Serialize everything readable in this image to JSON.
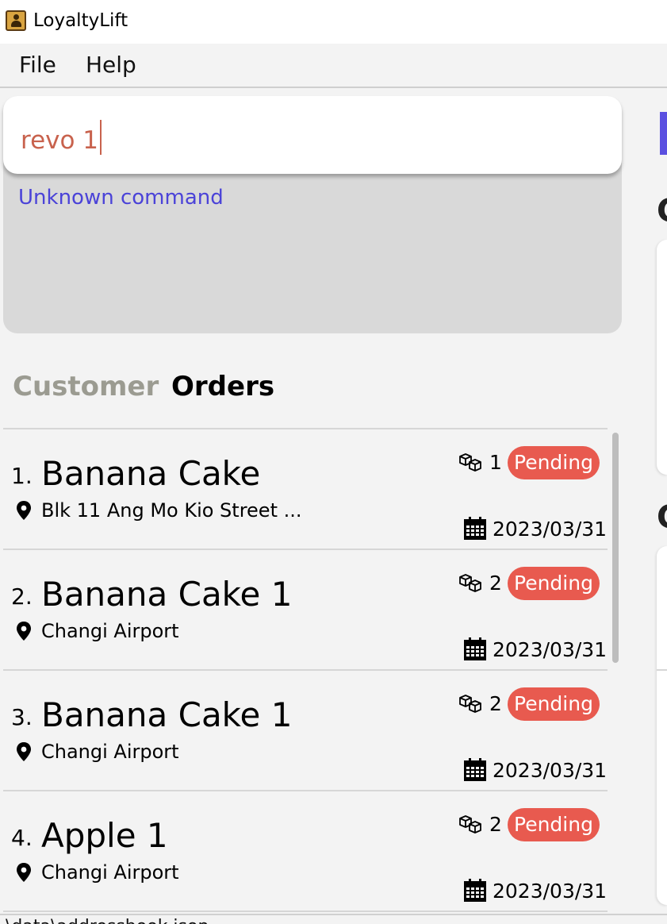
{
  "window": {
    "title": "LoyaltyLift",
    "icon": "contact-book-icon"
  },
  "menu": {
    "items": [
      "File",
      "Help"
    ]
  },
  "command": {
    "input_value": "revo 1",
    "result": "Unknown command"
  },
  "tabs": [
    {
      "label": "Customer",
      "selected": false
    },
    {
      "label": "Orders",
      "selected": true
    }
  ],
  "orders": [
    {
      "index": "1.",
      "name": "Banana Cake",
      "address": "Blk 11 Ang Mo Kio Street ...",
      "quantity": "1",
      "status": "Pending",
      "date": "2023/03/31"
    },
    {
      "index": "2.",
      "name": "Banana Cake 1",
      "address": "Changi Airport",
      "quantity": "2",
      "status": "Pending",
      "date": "2023/03/31"
    },
    {
      "index": "3.",
      "name": "Banana Cake 1",
      "address": "Changi Airport",
      "quantity": "2",
      "status": "Pending",
      "date": "2023/03/31"
    },
    {
      "index": "4.",
      "name": "Apple 1",
      "address": "Changi Airport",
      "quantity": "2",
      "status": "Pending",
      "date": "2023/03/31"
    }
  ],
  "right_panel": {
    "heading_1": "C",
    "heading_2": "C"
  },
  "status_bar": {
    "text": ".\\data\\addressbook.json"
  },
  "colors": {
    "status_pending": "#e85a4f",
    "command_text": "#c8624d",
    "result_text": "#4b43d8",
    "accent": "#5b50e0"
  }
}
